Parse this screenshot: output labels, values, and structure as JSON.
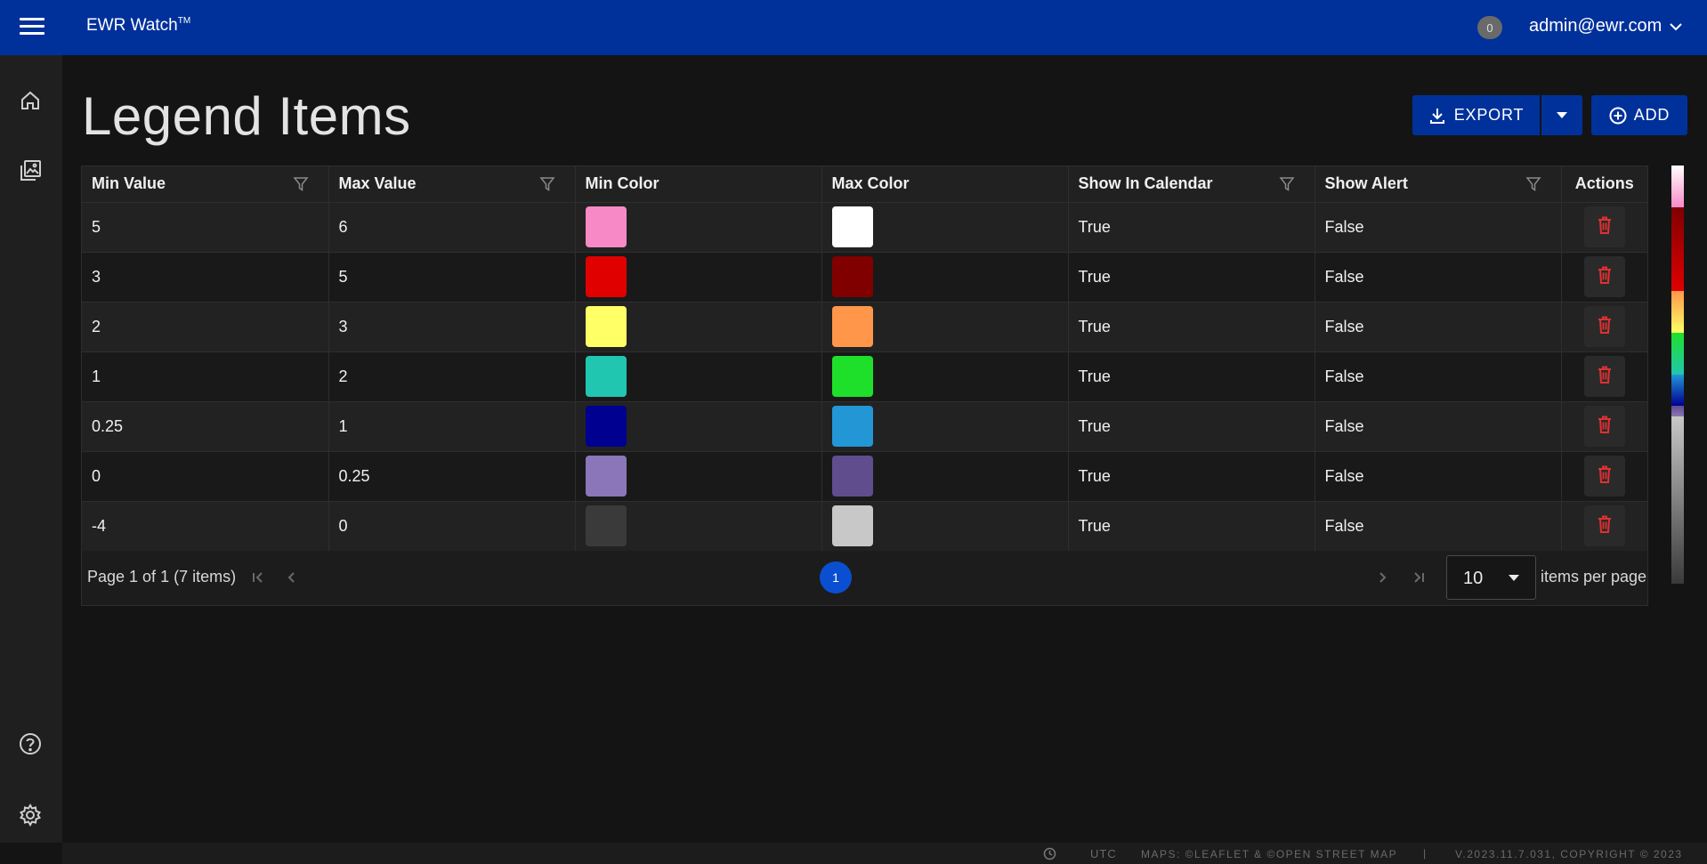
{
  "header": {
    "app_name": "EWR Watch",
    "trademark": "TM",
    "notification_count": "0",
    "user_email": "admin@ewr.com"
  },
  "sidebar": {
    "icons": [
      "home-icon",
      "gallery-icon",
      "help-icon",
      "settings-icon"
    ]
  },
  "page": {
    "title": "Legend Items",
    "export_label": "EXPORT",
    "add_label": "ADD"
  },
  "table": {
    "columns": [
      "Min Value",
      "Max Value",
      "Min Color",
      "Max Color",
      "Show In Calendar",
      "Show Alert",
      "Actions"
    ],
    "rows": [
      {
        "min_value": "5",
        "max_value": "6",
        "min_color": "#f78ac6",
        "max_color": "#ffffff",
        "show_in_calendar": "True",
        "show_alert": "False"
      },
      {
        "min_value": "3",
        "max_value": "5",
        "min_color": "#e00000",
        "max_color": "#800000",
        "show_in_calendar": "True",
        "show_alert": "False"
      },
      {
        "min_value": "2",
        "max_value": "3",
        "min_color": "#ffff66",
        "max_color": "#ff964a",
        "show_in_calendar": "True",
        "show_alert": "False"
      },
      {
        "min_value": "1",
        "max_value": "2",
        "min_color": "#20c6b0",
        "max_color": "#1ee02a",
        "show_in_calendar": "True",
        "show_alert": "False"
      },
      {
        "min_value": "0.25",
        "max_value": "1",
        "min_color": "#000090",
        "max_color": "#2396d6",
        "show_in_calendar": "True",
        "show_alert": "False"
      },
      {
        "min_value": "0",
        "max_value": "0.25",
        "min_color": "#8a76b8",
        "max_color": "#5f4d8e",
        "show_in_calendar": "True",
        "show_alert": "False"
      },
      {
        "min_value": "-4",
        "max_value": "0",
        "min_color": "#3a3a3a",
        "max_color": "#c8c8c8",
        "show_in_calendar": "True",
        "show_alert": "False"
      }
    ]
  },
  "pager": {
    "info": "Page 1 of 1 (7 items)",
    "current_page": "1",
    "page_size": "10",
    "per_page_label": "items per page"
  },
  "footer": {
    "timezone": "UTC",
    "maps_credit": "MAPS: ©LEAFLET & ©OPEN STREET MAP",
    "separator": "|",
    "version": "V.2023.11.7.031, COPYRIGHT © 2023"
  },
  "colors": {
    "accent": "#00319b",
    "delete": "#e03030",
    "page_active": "#0a4fd1"
  }
}
